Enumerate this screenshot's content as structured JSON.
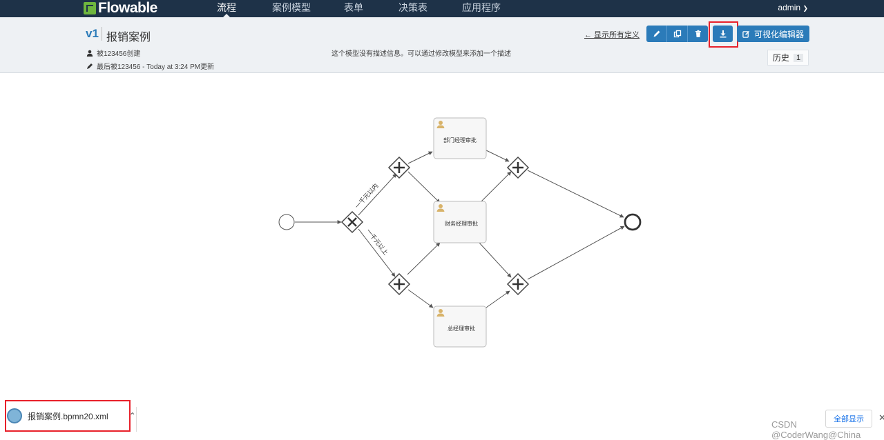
{
  "nav": {
    "brand": "Flowable",
    "items": [
      "流程",
      "案例模型",
      "表单",
      "决策表",
      "应用程序"
    ],
    "active": "流程",
    "user": "admin"
  },
  "header": {
    "version": "v1",
    "model_name": "报销案例",
    "created_by": "被123456创建",
    "updated_by": "最后被123456 - Today at 3:24 PM更新",
    "description": "这个模型没有描述信息。可以通过修改模型来添加一个描述",
    "back_link": "← 显示所有定义",
    "editor_button": "可视化编辑器",
    "history_label": "历史",
    "history_count": "1",
    "toolbar_icons": [
      "pencil-icon",
      "copy-icon",
      "trash-icon",
      "download-icon"
    ]
  },
  "diagram": {
    "tasks": [
      "部门经理审批",
      "财务经理审批",
      "总经理审批"
    ],
    "flow_labels": [
      "一千元以内",
      "一千元以上"
    ]
  },
  "download_bar": {
    "file_name": "报销案例.bpmn20.xml",
    "show_all": "全部显示"
  },
  "watermark": "CSDN @CoderWang@China",
  "colors": {
    "navbar": "#1e3248",
    "primary": "#2b7bb9",
    "header_bg": "#eef1f4",
    "highlight": "#e8202a",
    "brand_green": "#6fb63e"
  }
}
